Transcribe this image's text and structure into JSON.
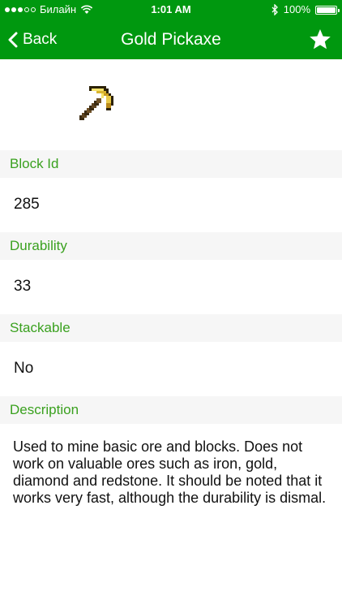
{
  "status_bar": {
    "carrier": "Билайн",
    "time": "1:01 AM",
    "battery": "100%"
  },
  "nav": {
    "back_label": "Back",
    "title": "Gold Pickaxe"
  },
  "item": {
    "image_icon": "gold-pickaxe-icon",
    "fields": [
      {
        "label": "Block Id",
        "value": "285"
      },
      {
        "label": "Durability",
        "value": "33"
      },
      {
        "label": "Stackable",
        "value": "No"
      },
      {
        "label": "Description",
        "value": "Used to mine basic ore and blocks.  Does not work on valuable ores such as iron, gold, diamond and redstone. It should be noted that it works very fast, although the durability is dismal."
      }
    ]
  },
  "colors": {
    "bar": "#00980f",
    "section_label": "#3aa11f"
  }
}
